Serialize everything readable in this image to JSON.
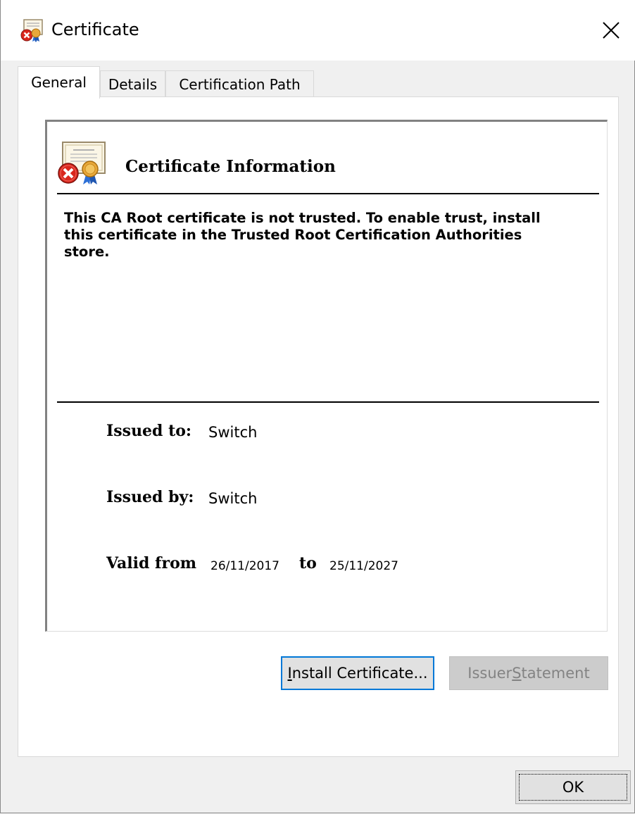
{
  "window": {
    "title": "Certificate",
    "title_icon": "certificate-untrusted-icon",
    "close_icon": "close-icon"
  },
  "tabs": [
    {
      "label": "General",
      "active": true
    },
    {
      "label": "Details",
      "active": false
    },
    {
      "label": "Certification Path",
      "active": false
    }
  ],
  "info": {
    "icon": "certificate-untrusted-icon",
    "heading": "Certificate Information",
    "warning": "This CA Root certificate is not trusted. To enable trust, install this certificate in the Trusted Root Certification Authorities store.",
    "issued_to_label": "Issued to:",
    "issued_to_value": "Switch",
    "issued_by_label": "Issued by:",
    "issued_by_value": "Switch",
    "valid_from_label": "Valid from",
    "valid_from_value": "26/11/2017",
    "valid_to_label": "to",
    "valid_to_value": "25/11/2027"
  },
  "buttons": {
    "install_certificate": "Install Certificate...",
    "install_certificate_underline": "I",
    "install_certificate_rest": "nstall Certificate...",
    "issuer_statement": "Issuer Statement",
    "issuer_statement_pre": "Issuer ",
    "issuer_statement_underline": "S",
    "issuer_statement_rest": "tatement",
    "ok": "OK"
  },
  "colors": {
    "accent": "#0078d7",
    "error_red": "#d9261c",
    "seal_gold": "#e8a83a",
    "ribbon_blue": "#2c6fd6"
  }
}
